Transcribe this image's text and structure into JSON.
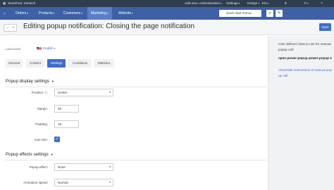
{
  "topbar": {
    "storefront": "Storefront: Simtech",
    "addons": "Add-ons",
    "administration": "Administration",
    "settings": "Settings",
    "design": "Design",
    "lang": "EN",
    "profile": "F"
  },
  "nav": {
    "home_icon": "home-icon",
    "items": [
      {
        "label": "Orders"
      },
      {
        "label": "Products"
      },
      {
        "label": "Customers"
      },
      {
        "label": "Marketing"
      },
      {
        "label": "Website"
      }
    ],
    "quick_menu": "Quick start menu"
  },
  "title": "Editing popup notification: Closing the page notification",
  "save_label": "Save",
  "language": {
    "label": "LANGUAGE:",
    "value": "English"
  },
  "tabs": [
    {
      "label": "General"
    },
    {
      "label": "Content"
    },
    {
      "label": "Settings"
    },
    {
      "label": "Conditions"
    },
    {
      "label": "Statistics"
    }
  ],
  "display": {
    "heading": "Popup display settings",
    "position_label": "Position",
    "position_value": "Center",
    "margin_label": "Margin:",
    "margin_value": "20",
    "padding_label": "Padding:",
    "padding_value": "15",
    "autosize_label": "Auto size:"
  },
  "effects": {
    "heading": "Popup effects settings",
    "effect_label": "Popup effect:",
    "effect_value": "None",
    "speed_label": "Animation speed:",
    "speed_value": "Normal"
  },
  "sidebar": {
    "text": "User defined class to use for manual popup call:",
    "code": "open-power-popup power-popup-1",
    "link": "View/Hide instructions of manual pop-up call"
  },
  "colors": {
    "accent": "#3f6fc7",
    "nav": "#3f5fa7",
    "topbar": "#2e3e4e"
  }
}
